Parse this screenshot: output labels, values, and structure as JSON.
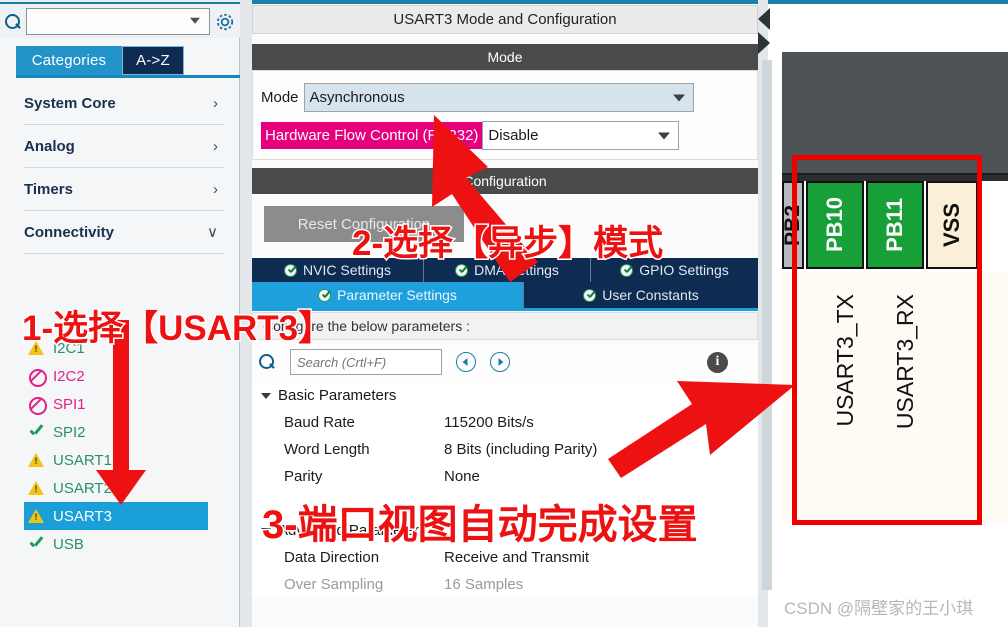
{
  "left_panel": {
    "search": {
      "value": "",
      "placeholder": ""
    },
    "gear_icon": "gear-icon",
    "tabs": [
      {
        "label": "Categories",
        "selected": true
      },
      {
        "label": "A->Z",
        "selected": false
      }
    ],
    "categories": [
      {
        "label": "System Core",
        "chevron": "›"
      },
      {
        "label": "Analog",
        "chevron": "›"
      },
      {
        "label": "Timers",
        "chevron": "›"
      },
      {
        "label": "Connectivity",
        "chevron": "∨"
      }
    ],
    "peripherals": [
      {
        "label": "I2C1",
        "status": "warning",
        "selected": false
      },
      {
        "label": "I2C2",
        "status": "disabled",
        "selected": false
      },
      {
        "label": "SPI1",
        "status": "disabled",
        "selected": false
      },
      {
        "label": "SPI2",
        "status": "ok",
        "selected": false
      },
      {
        "label": "USART1",
        "status": "warning",
        "selected": false
      },
      {
        "label": "USART2",
        "status": "warning",
        "selected": false
      },
      {
        "label": "USART3",
        "status": "warning",
        "selected": true
      },
      {
        "label": "USB",
        "status": "ok",
        "selected": false
      }
    ]
  },
  "middle_panel": {
    "title": "USART3 Mode and Configuration",
    "mode_section_label": "Mode",
    "mode_field": {
      "label": "Mode",
      "value": "Asynchronous"
    },
    "hardware_flow_control": {
      "label": "Hardware Flow Control (RS232)",
      "value": "Disable"
    },
    "configuration_section_label": "Configuration",
    "reset_button": "Reset Configuration",
    "tabs_row1": [
      {
        "label": "NVIC Settings",
        "active": false
      },
      {
        "label": "DMA Settings",
        "active": false
      },
      {
        "label": "GPIO Settings",
        "active": false
      }
    ],
    "tabs_row2": [
      {
        "label": "Parameter Settings",
        "active": true
      },
      {
        "label": "User Constants",
        "active": false
      }
    ],
    "configure_hint": "Configure the below parameters :",
    "param_search": {
      "value": "",
      "placeholder": "Search (Crtl+F)"
    },
    "info_icon": "info-icon",
    "groups": [
      {
        "name": "Basic Parameters",
        "expanded": true,
        "rows": [
          {
            "key": "Baud Rate",
            "value": "115200 Bits/s",
            "dim": false
          },
          {
            "key": "Word Length",
            "value": "8 Bits (including Parity)",
            "dim": false
          },
          {
            "key": "Parity",
            "value": "None",
            "dim": false
          }
        ]
      },
      {
        "name": "Advanced Parameters",
        "expanded": true,
        "rows": [
          {
            "key": "Data Direction",
            "value": "Receive and Transmit",
            "dim": false
          },
          {
            "key": "Over Sampling",
            "value": "16 Samples",
            "dim": true
          }
        ]
      }
    ]
  },
  "right_panel": {
    "pins": [
      {
        "label": "PB2",
        "kind": "gray"
      },
      {
        "label": "PB10",
        "kind": "green"
      },
      {
        "label": "PB11",
        "kind": "green"
      },
      {
        "label": "VSS",
        "kind": "cream"
      }
    ],
    "pin_signals": [
      {
        "label": "USART3_TX"
      },
      {
        "label": "USART3_RX"
      }
    ],
    "watermark": "CSDN @隔壁家的王小琪"
  },
  "annotations": [
    {
      "id": 1,
      "text": "1-选择【USART3】"
    },
    {
      "id": 2,
      "text": "2-选择【异步】模式"
    },
    {
      "id": 3,
      "text": "3-端口视图自动完成设置"
    }
  ],
  "colors": {
    "accent_blue": "#1fa0dc",
    "tab_navy": "#0e2b52",
    "magenta": "#e6007e",
    "pin_green": "#18a038",
    "annotation_red": "#ee1111",
    "warning_yellow": "#f0c419"
  }
}
